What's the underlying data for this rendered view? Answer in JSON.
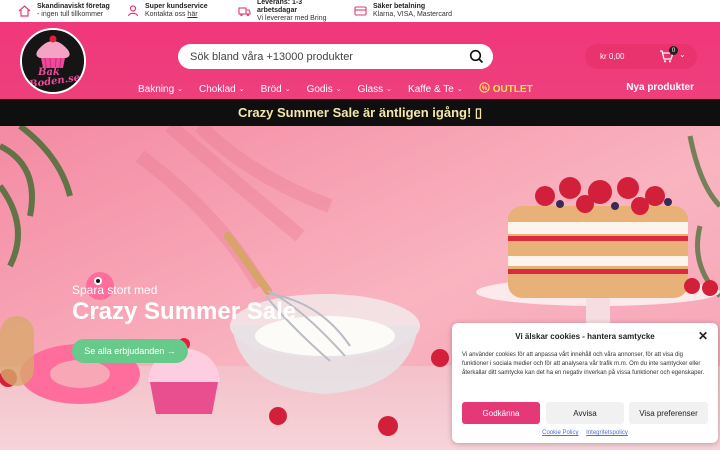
{
  "usps": [
    {
      "icon": "home-icon",
      "title": "Skandinaviskt företag",
      "sub": "- ingen tull tillkommer"
    },
    {
      "icon": "person-icon",
      "title": "Super kundservice",
      "sub_prefix": "Kontakta oss ",
      "sub_link": "här"
    },
    {
      "icon": "truck-icon",
      "title": "Leverans: 1-3 arbetsdagar",
      "sub": "Vi levererar med Bring"
    },
    {
      "icon": "card-icon",
      "title": "Säker betalning",
      "sub": "Klarna, VISA, Mastercard"
    }
  ],
  "logo": {
    "text_top": "Bak",
    "text_bottom": "Boden.se"
  },
  "search": {
    "placeholder": "Sök bland våra +13000 produkter",
    "value": ""
  },
  "cart": {
    "amount": "kr 0,00",
    "count": "0"
  },
  "nav": {
    "items": [
      "Bakning",
      "Choklad",
      "Bröd",
      "Godis",
      "Glass",
      "Kaffe & Te"
    ],
    "outlet": "OUTLET",
    "new_products": "Nya produkter"
  },
  "promo": {
    "text": "Crazy Summer Sale är äntligen igång! ▯"
  },
  "hero": {
    "eyebrow": "Spara stort med",
    "title": "Crazy Summer Sale",
    "cta": "Se alla erbjudanden →"
  },
  "cookie": {
    "title": "Vi älskar cookies - hantera samtycke",
    "body": "Vi använder cookies för att anpassa vårt innehåll och våra annonser, för att visa dig funktioner i sociala medier och för att analysera vår trafik m.m. Om du inte samtycker eller återkallar ditt samtycke kan det ha en negativ inverkan på vissa funktioner och egenskaper.",
    "accept": "Godkänna",
    "deny": "Avvisa",
    "prefs": "Visa preferenser",
    "link_cookie": "Cookie Policy",
    "link_privacy": "Integritetspolicy"
  },
  "colors": {
    "brand_pink": "#ee3f7c",
    "outlet_yellow": "#ffe84d",
    "cta_green": "#67c98a",
    "link_blue": "#4d6ed8"
  }
}
